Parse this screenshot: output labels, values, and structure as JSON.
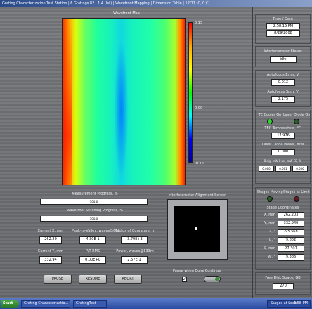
{
  "window": {
    "title": "Grating Characterization Test Station | 6 Gratings 82 | 1.4 (Int) | Wavefront Mapping | Dimension Table | 12/11 (C, 0 C)"
  },
  "map": {
    "title": "Wavefront Map",
    "scale_max": "0.15",
    "scale_mid": "0.00",
    "scale_min": "-0.15"
  },
  "progress": {
    "measurement_label": "Measurement Progress, %",
    "measurement_value": 100,
    "measurement_text": "100.0",
    "stitching_label": "Wavefront Stitching Progress, %",
    "stitching_value": 100,
    "stitching_text": "100.0"
  },
  "alignment": {
    "title": "Interferometer Alignment Screen"
  },
  "readouts": {
    "current_x_label": "Current X, mm",
    "current_x_value": "262.20",
    "ptv_label": "Peak-to-Valley, waves@633",
    "ptv_value": "4.30E-1",
    "radius_label": "Radius of Curvature, m",
    "radius_value": "-3.79E+3",
    "current_y_label": "Current Y, mm",
    "current_y_value": "332.94",
    "rms_label": "P/T RMS",
    "rms_value": "0.00E+0",
    "power_label": "Power, waves@633m",
    "power_value": "2.57E-1"
  },
  "buttons": {
    "pause": "PAUSE",
    "resume": "RESUME",
    "abort": "ABORT"
  },
  "pause_when_done": {
    "label": "Pause when Done",
    "checked": true
  },
  "continue_toggle": {
    "label": "Continue"
  },
  "side": {
    "time_label": "Time / Date",
    "time_value": "2:58:15 PM",
    "date_value": "8/29/2008",
    "interferometer_label": "Interferometer Status",
    "interferometer_value": "idle",
    "autofocus_error_label": "Autofocus Error, V",
    "autofocus_error_value": "0.012",
    "autofocus_sum_label": "Autofocus Sum, V",
    "autofocus_sum_value": "2.175",
    "tec_cooler_label": "TE Cooler On",
    "laser_diode_label": "Laser Diode On",
    "tec_temp_label": "TEC Temperature, °C",
    "tec_temp_value": "17.976",
    "laser_power_label": "Laser Diode Power, mW",
    "laser_power_value": "0.000",
    "pwd_label": "P sig, mW   P ref, mW   ER, %",
    "pwd_values": [
      "0.000",
      "0.001",
      "0.000"
    ],
    "stages_moving_label": "Stages Moving",
    "stages_at_limit_label": "Stages at Limit",
    "stage_coords_label": "Stage Coordinates",
    "coords": [
      {
        "label": "X, mm",
        "value": "262.203"
      },
      {
        "label": "Y, mm",
        "value": "332.940"
      },
      {
        "label": "Z, °",
        "value": "-95.568"
      },
      {
        "label": "U, °",
        "value": "9.802"
      },
      {
        "label": "P, mm",
        "value": "27.307"
      },
      {
        "label": "W, °",
        "value": "9.385"
      }
    ],
    "free_disk_label": "Free Disk Space, GB",
    "free_disk_value": "270"
  },
  "taskbar": {
    "start": "Start",
    "tasks": [
      "Grating Characterizatio...",
      "GratingTest"
    ],
    "tray": "Stages at Lock",
    "clock": "2:58 PM"
  },
  "colors": {
    "led_green": "#36d23a",
    "led_dark_green": "#2a5a2a",
    "led_dark_red": "#5a2020"
  }
}
